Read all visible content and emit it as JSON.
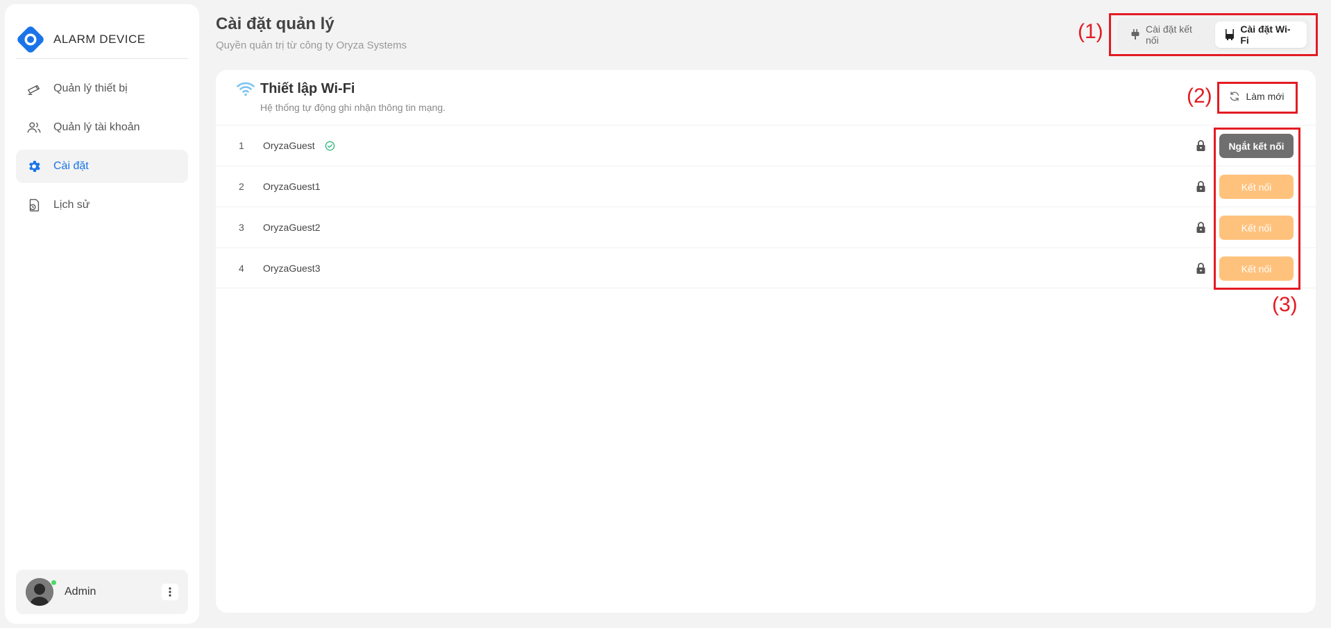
{
  "app": {
    "name": "ALARM DEVICE"
  },
  "colors": {
    "accent": "#1a74e8",
    "annotation": "#e31b23",
    "connect": "#ffc27d",
    "disconnect": "#6f6f6f",
    "online": "#4cd964",
    "connected_check": "#2fb37a",
    "wifi": "#7cc4f0"
  },
  "sidebar": {
    "items": [
      {
        "label": "Quản lý thiết bị",
        "icon": "cctv-camera-icon",
        "active": false
      },
      {
        "label": "Quản lý tài khoản",
        "icon": "users-icon",
        "active": false
      },
      {
        "label": "Cài đặt",
        "icon": "gear-icon",
        "active": true
      },
      {
        "label": "Lịch sử",
        "icon": "history-file-icon",
        "active": false
      }
    ],
    "user": {
      "name": "Admin",
      "status": "online"
    }
  },
  "header": {
    "title": "Cài đặt quản lý",
    "subtitle": "Quyền quản trị từ công ty Oryza Systems",
    "tabs": [
      {
        "label": "Cài đặt kết nối",
        "icon": "plug-icon",
        "active": false
      },
      {
        "label": "Cài đặt Wi-Fi",
        "icon": "router-icon",
        "active": true
      }
    ]
  },
  "annotations": {
    "a1": "(1)",
    "a2": "(2)",
    "a3": "(3)"
  },
  "wifi": {
    "title": "Thiết lập Wi-Fi",
    "subtitle": "Hệ thống tự động ghi nhận thông tin mạng.",
    "refresh_label": "Làm mới",
    "networks": [
      {
        "index": "1",
        "ssid": "OryzaGuest",
        "connected": true,
        "secured": true,
        "action": "Ngắt kết nối"
      },
      {
        "index": "2",
        "ssid": "OryzaGuest1",
        "connected": false,
        "secured": true,
        "action": "Kết nối"
      },
      {
        "index": "3",
        "ssid": "OryzaGuest2",
        "connected": false,
        "secured": true,
        "action": "Kết nối"
      },
      {
        "index": "4",
        "ssid": "OryzaGuest3",
        "connected": false,
        "secured": true,
        "action": "Kết nối"
      }
    ]
  }
}
